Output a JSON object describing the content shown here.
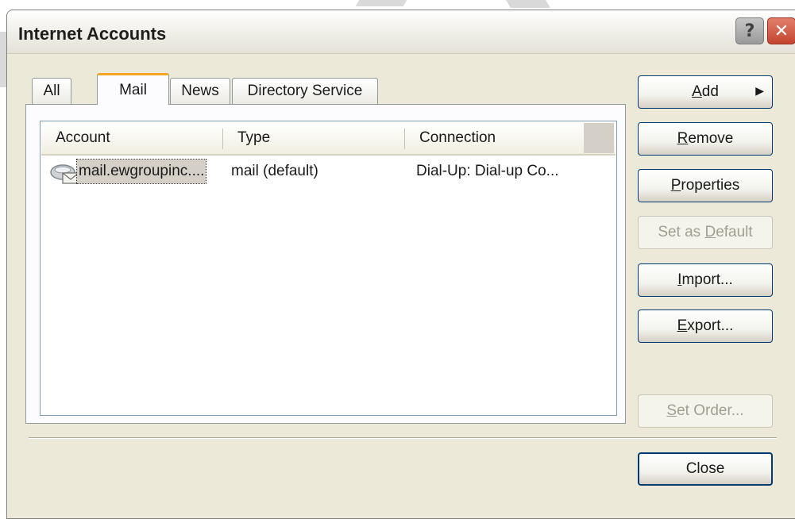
{
  "window": {
    "title": "Internet Accounts"
  },
  "tabs": [
    {
      "label": "All"
    },
    {
      "label": "Mail"
    },
    {
      "label": "News"
    },
    {
      "label": "Directory Service"
    }
  ],
  "list": {
    "columns": [
      "Account",
      "Type",
      "Connection"
    ],
    "rows": [
      {
        "account": "mail.ewgroupinc....",
        "type": "mail (default)",
        "connection": "Dial-Up: Dial-up Co..."
      }
    ]
  },
  "buttons": {
    "add": {
      "mnemonic": "A",
      "rest": "dd"
    },
    "remove": {
      "mnemonic": "R",
      "rest": "emove"
    },
    "properties": {
      "mnemonic": "P",
      "rest": "roperties"
    },
    "set_default": {
      "before": "Set as ",
      "mnemonic": "D",
      "rest": "efault"
    },
    "import": {
      "mnemonic": "I",
      "rest": "mport..."
    },
    "export": {
      "mnemonic": "E",
      "rest": "xport..."
    },
    "set_order": {
      "mnemonic": "S",
      "rest": "et Order..."
    },
    "close": "Close"
  },
  "colors": {
    "selection_bg": "#d4d0c8",
    "close_red": "#c3452f",
    "tab_highlight": "#f5a623"
  }
}
